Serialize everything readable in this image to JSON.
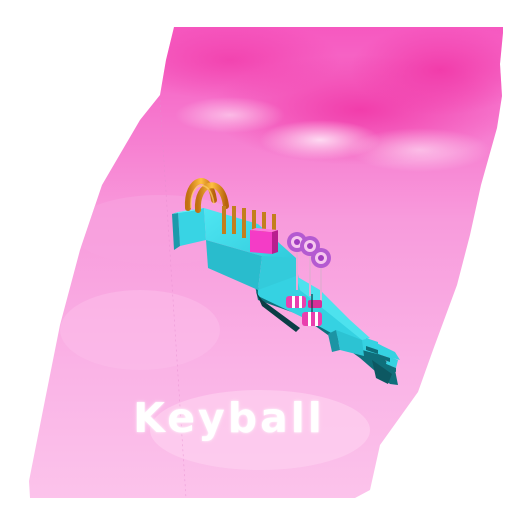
{
  "game": {
    "title": "Keyball"
  },
  "colors": {
    "sky_top": "#f35bc0",
    "sky_mid": "#f797d9",
    "sky_bottom": "#fbb8e7",
    "track": "#35d8e8",
    "track_dark": "#1a98a8",
    "gate_gold": "#f5a628",
    "block_magenta": "#f43cc6",
    "lollipop_purple": "#a84bc8",
    "title_text": "#ffffff"
  },
  "icons": [
    "gold-arch-icon",
    "lollipop-icon",
    "candy-barrel-icon"
  ]
}
